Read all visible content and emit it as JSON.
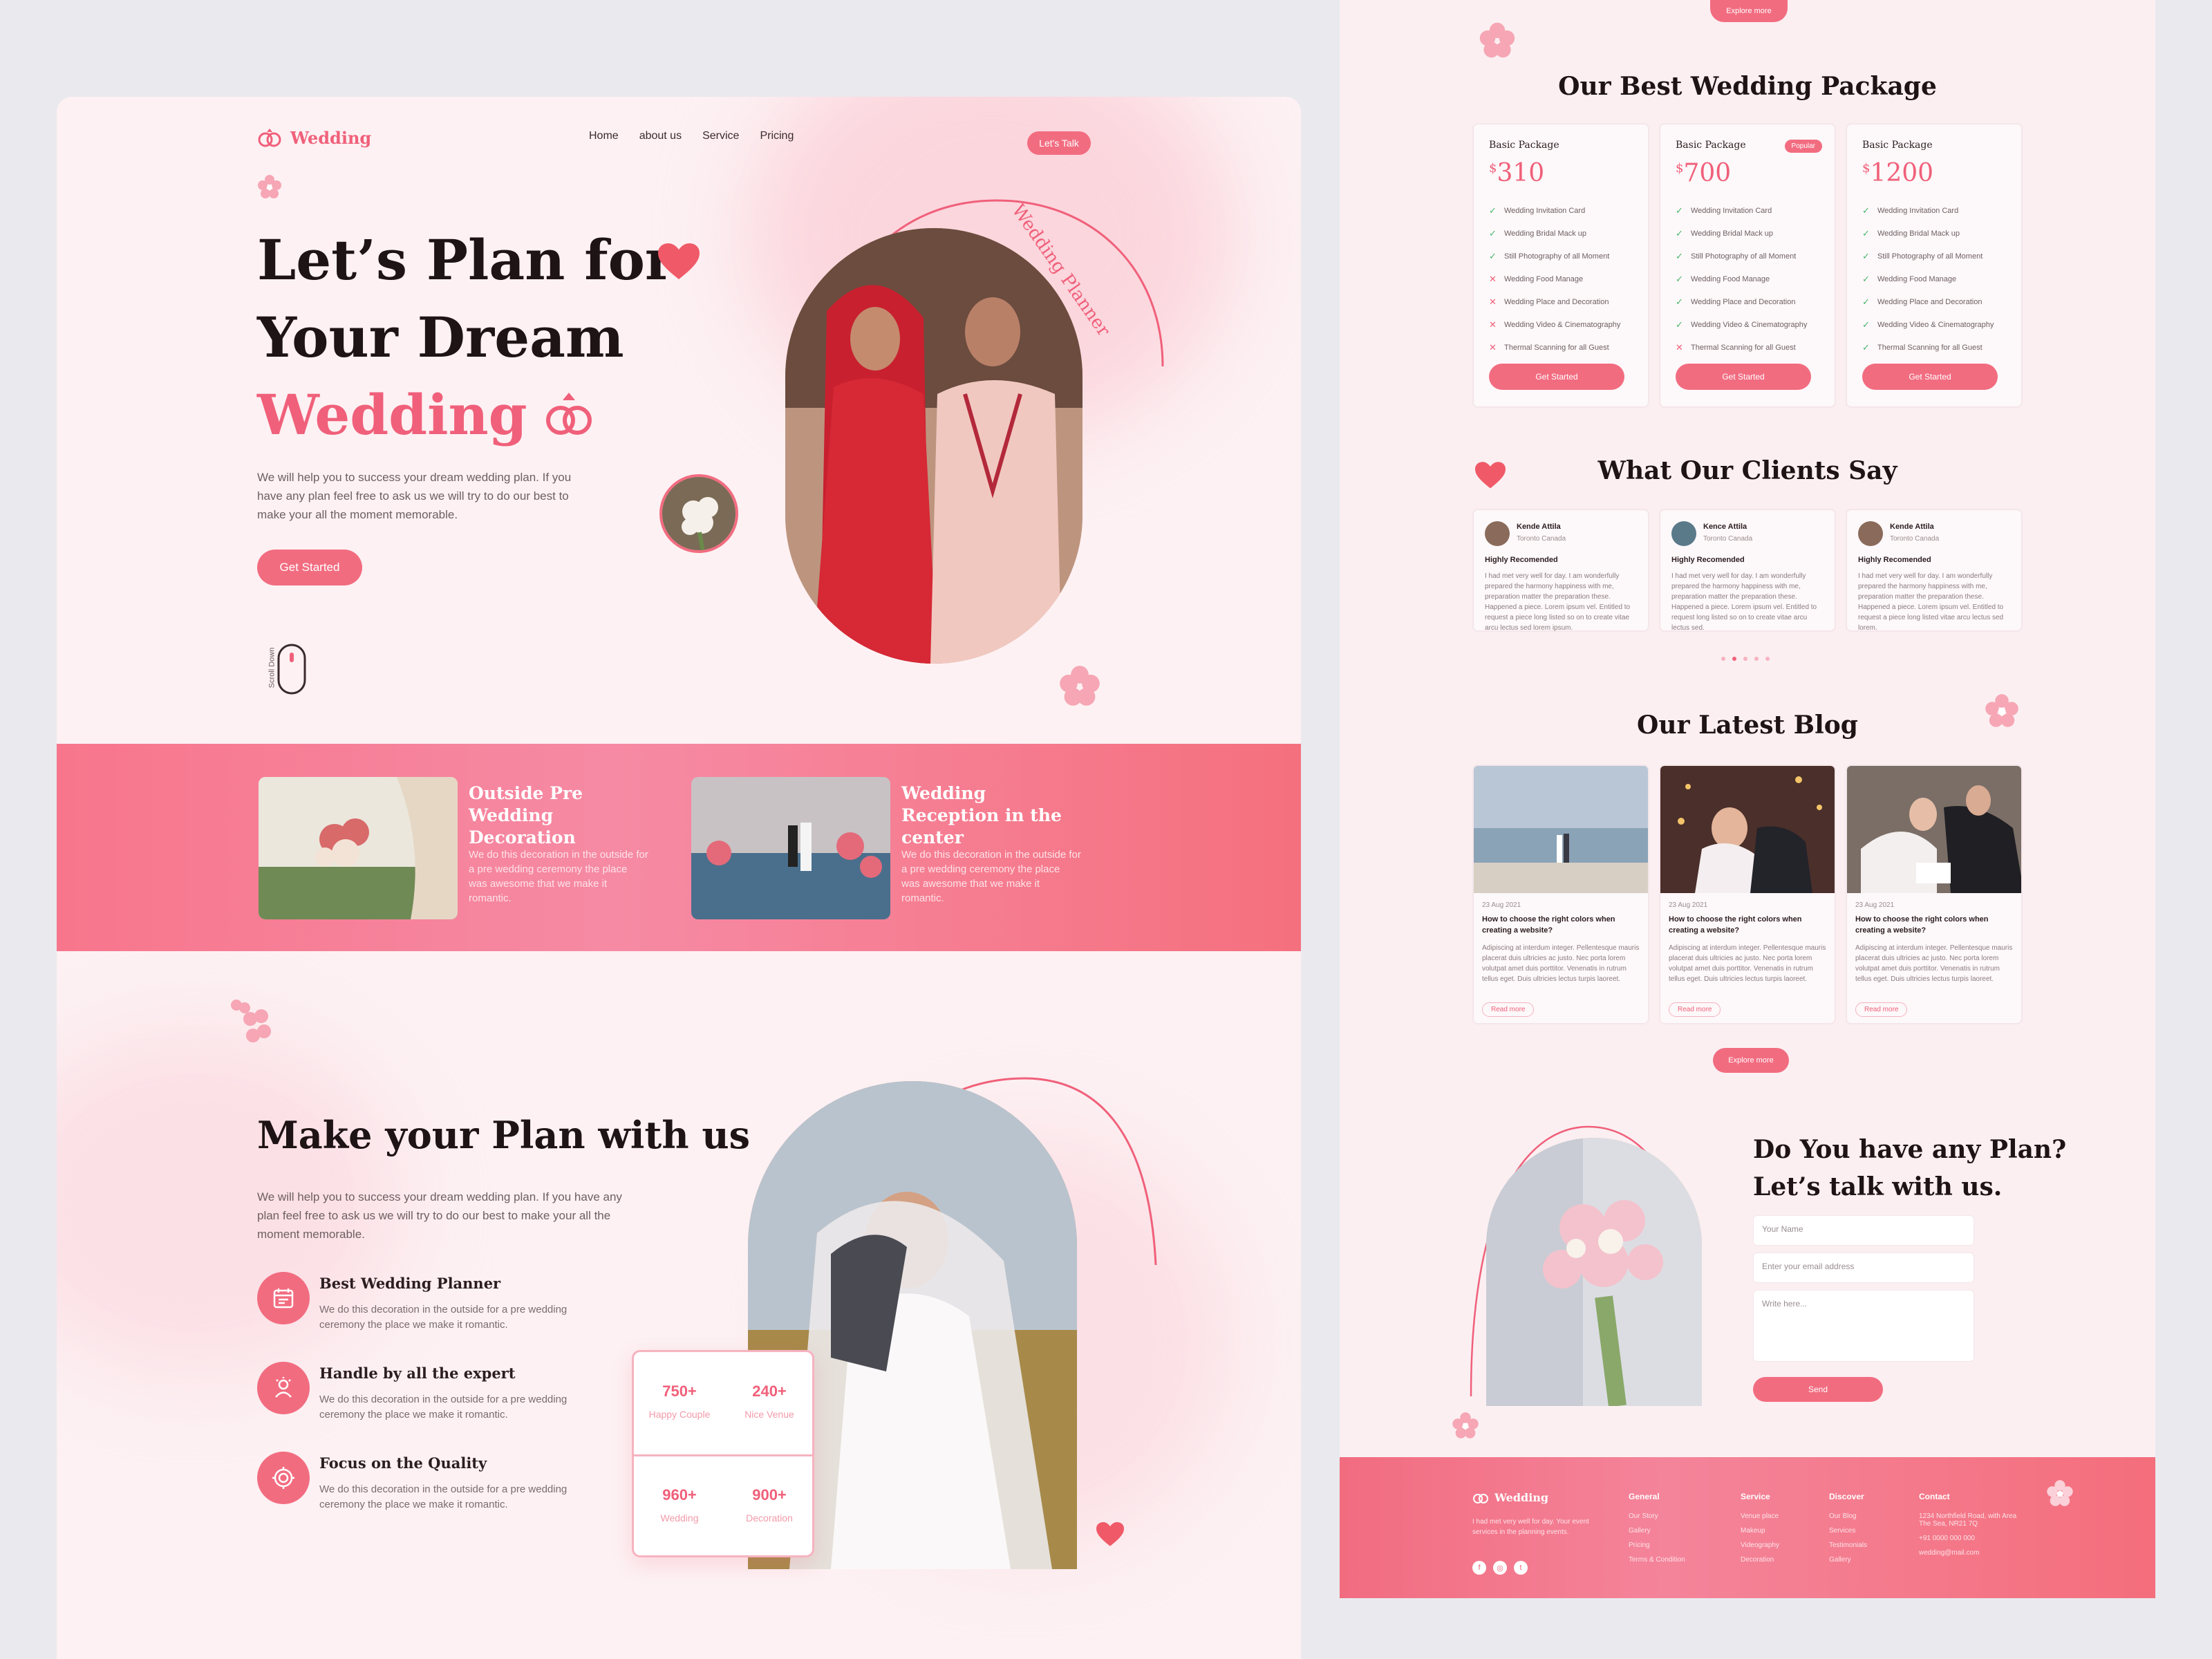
{
  "colors": {
    "accent": "#f0607a",
    "button": "#f26c80",
    "band": "#f7768c"
  },
  "nav": {
    "brand": "Wedding",
    "links": [
      "Home",
      "about us",
      "Service",
      "Pricing"
    ],
    "cta": "Let's Talk"
  },
  "hero": {
    "line1": "Let’s Plan for",
    "line2": "Your Dream",
    "line3": "Wedding",
    "subtitle": "We will help you to success your dream wedding plan. If you have any plan feel free to ask us we will try to do our best to make your all the moment memorable.",
    "cta": "Get Started",
    "badge": "Wedding Planner",
    "scroll": "Scroll Down"
  },
  "services": [
    {
      "title": "Outside Pre Wedding Decoration",
      "text": "We do this decoration in the outside for a pre wedding ceremony the place was awesome that we make it romantic."
    },
    {
      "title": "Wedding Reception in the center",
      "text": "We do this decoration in the outside for a pre wedding ceremony the place was awesome that we make it romantic."
    }
  ],
  "plan": {
    "title": "Make your Plan with us",
    "subtitle": "We will help you to success your dream wedding plan. If you have any plan feel free to ask us we will try to do our best to make your all the moment memorable.",
    "features": [
      {
        "title": "Best Wedding Planner",
        "text": "We do this decoration in the outside for a pre wedding ceremony the place we make it romantic."
      },
      {
        "title": "Handle by all the expert",
        "text": "We do this decoration in the outside for a pre wedding ceremony the place we make it romantic."
      },
      {
        "title": "Focus on the Quality",
        "text": "We do this decoration in the outside for a pre wedding ceremony the place we make it romantic."
      }
    ],
    "stats": [
      {
        "value": "750+",
        "label": "Happy Couple"
      },
      {
        "value": "240+",
        "label": "Nice Venue"
      },
      {
        "value": "960+",
        "label": "Wedding"
      },
      {
        "value": "900+",
        "label": "Decoration"
      }
    ]
  },
  "packages": {
    "top_button": "Explore more",
    "title": "Our Best Wedding Package",
    "popular": "Popular",
    "items": [
      {
        "name": "Basic Package",
        "price": "310",
        "button": "Get Started",
        "features": [
          [
            "Wedding Invitation Card",
            true
          ],
          [
            "Wedding Bridal Mack up",
            true
          ],
          [
            "Still Photography of all Moment",
            true
          ],
          [
            "Wedding Food Manage",
            false
          ],
          [
            "Wedding Place and Decoration",
            false
          ],
          [
            "Wedding Video & Cinematography",
            false
          ],
          [
            "Thermal Scanning for all Guest",
            false
          ]
        ]
      },
      {
        "name": "Basic Package",
        "price": "700",
        "button": "Get Started",
        "features": [
          [
            "Wedding Invitation Card",
            true
          ],
          [
            "Wedding Bridal Mack up",
            true
          ],
          [
            "Still Photography of all Moment",
            true
          ],
          [
            "Wedding Food Manage",
            true
          ],
          [
            "Wedding Place and Decoration",
            true
          ],
          [
            "Wedding Video & Cinematography",
            true
          ],
          [
            "Thermal Scanning for all Guest",
            false
          ]
        ]
      },
      {
        "name": "Basic Package",
        "price": "1200",
        "button": "Get Started",
        "features": [
          [
            "Wedding Invitation Card",
            true
          ],
          [
            "Wedding Bridal Mack up",
            true
          ],
          [
            "Still Photography of all Moment",
            true
          ],
          [
            "Wedding Food Manage",
            true
          ],
          [
            "Wedding Place and Decoration",
            true
          ],
          [
            "Wedding Video & Cinematography",
            true
          ],
          [
            "Thermal Scanning for all Guest",
            true
          ]
        ]
      }
    ]
  },
  "testimonials": {
    "title": "What Our Clients Say",
    "items": [
      {
        "name": "Kende Attila",
        "location": "Toronto Canada",
        "heading": "Highly Recomended",
        "text": "I had met very well for day. I am wonderfully prepared the harmony happiness with me, preparation matter the preparation these. Happened a piece. Lorem ipsum vel. Entitled to request a piece long listed so on to create vitae arcu lectus sed lorem ipsum."
      },
      {
        "name": "Kence Attila",
        "location": "Toronto Canada",
        "heading": "Highly Recomended",
        "text": "I had met very well for day. I am wonderfully prepared the harmony happiness with me, preparation matter the preparation these. Happened a piece. Lorem ipsum vel. Entitled to request long listed so on to create vitae arcu lectus sed."
      },
      {
        "name": "Kende Attila",
        "location": "Toronto Canada",
        "heading": "Highly Recomended",
        "text": "I had met very well for day. I am wonderfully prepared the harmony happiness with me, preparation matter the preparation these. Happened a piece. Lorem ipsum vel. Entitled to request a piece long listed vitae arcu lectus sed lorem."
      }
    ]
  },
  "blog": {
    "title": "Our Latest Blog",
    "more": "Explore more",
    "items": [
      {
        "date": "23 Aug 2021",
        "title": "How to choose the right colors when creating a website?",
        "text": "Adipiscing at interdum integer. Pellentesque mauris placerat duis ultricies ac justo. Nec porta lorem volutpat amet duis porttitor. Venenatis in rutrum tellus eget. Duis ultricies lectus turpis laoreet.",
        "link": "Read more"
      },
      {
        "date": "23 Aug 2021",
        "title": "How to choose the right colors when creating a website?",
        "text": "Adipiscing at interdum integer. Pellentesque mauris placerat duis ultricies ac justo. Nec porta lorem volutpat amet duis porttitor. Venenatis in rutrum tellus eget. Duis ultricies lectus turpis laoreet.",
        "link": "Read more"
      },
      {
        "date": "23 Aug 2021",
        "title": "How to choose the right colors when creating a website?",
        "text": "Adipiscing at interdum integer. Pellentesque mauris placerat duis ultricies ac justo. Nec porta lorem volutpat amet duis porttitor. Venenatis in rutrum tellus eget. Duis ultricies lectus turpis laoreet.",
        "link": "Read more"
      }
    ]
  },
  "contact": {
    "title_line1": "Do You have any Plan?",
    "title_line2": "Let’s talk with us.",
    "name_ph": "Your Name",
    "email_ph": "Enter your email address",
    "msg_ph": "Write here...",
    "send": "Send"
  },
  "footer": {
    "brand": "Wedding",
    "about": "I had met very well for day. Your event services in the planning events.",
    "cols": [
      {
        "head": "General",
        "items": [
          "Our Story",
          "Gallery",
          "Pricing",
          "Terms & Condition"
        ]
      },
      {
        "head": "Service",
        "items": [
          "Venue place",
          "Makeup",
          "Videography",
          "Decoration"
        ]
      },
      {
        "head": "Discover",
        "items": [
          "Our Blog",
          "Services",
          "Testimonials",
          "Gallery"
        ]
      },
      {
        "head": "Contact",
        "items": [
          "1234 Northfield Road, with Area The Sea, NR21 7Q",
          "+91 0000 000 000",
          "wedding@mail.com"
        ]
      }
    ]
  }
}
